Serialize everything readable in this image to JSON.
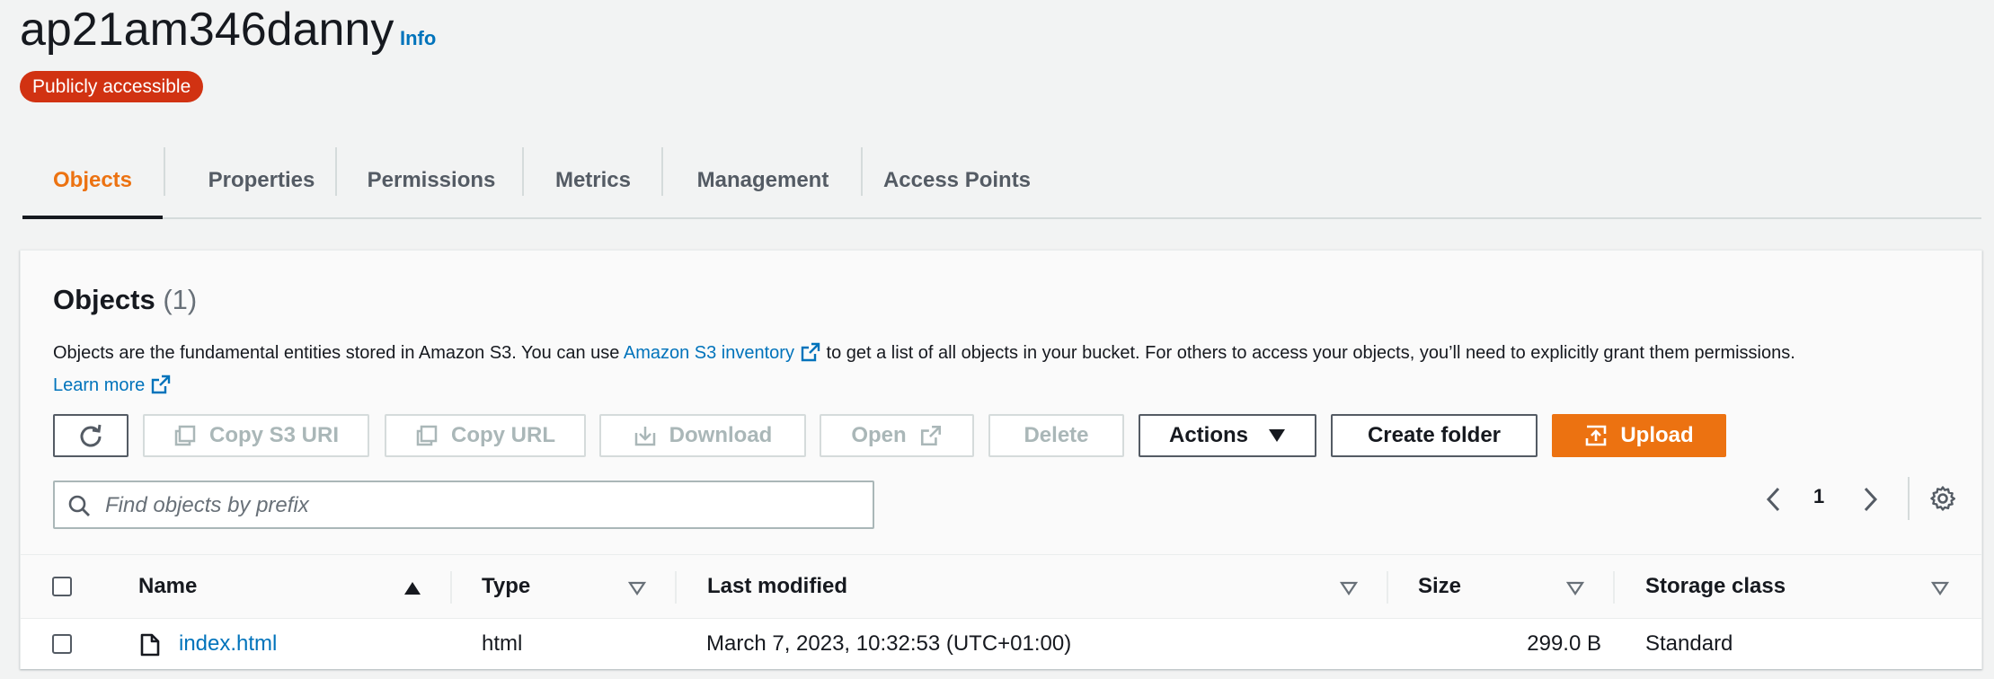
{
  "bucket": {
    "name": "ap21am346danny",
    "info_label": "Info",
    "access_badge": "Publicly accessible"
  },
  "tabs": [
    {
      "label": "Objects",
      "active": true
    },
    {
      "label": "Properties"
    },
    {
      "label": "Permissions"
    },
    {
      "label": "Metrics"
    },
    {
      "label": "Management"
    },
    {
      "label": "Access Points"
    }
  ],
  "objects_panel": {
    "title": "Objects",
    "count": "(1)",
    "description_before": "Objects are the fundamental entities stored in Amazon S3. You can use ",
    "inventory_link": "Amazon S3 inventory",
    "description_after": " to get a list of all objects in your bucket. For others to access your objects, you’ll need to explicitly grant them permissions.",
    "learn_more": "Learn more"
  },
  "toolbar": {
    "refresh_icon": "refresh-icon",
    "copy_s3_uri": "Copy S3 URI",
    "copy_url": "Copy URL",
    "download": "Download",
    "open": "Open",
    "delete": "Delete",
    "actions": "Actions",
    "create_folder": "Create folder",
    "upload": "Upload"
  },
  "search": {
    "placeholder": "Find objects by prefix",
    "value": ""
  },
  "pagination": {
    "current_page": "1"
  },
  "table": {
    "columns": [
      "Name",
      "Type",
      "Last modified",
      "Size",
      "Storage class"
    ],
    "rows": [
      {
        "name": "index.html",
        "type": "html",
        "last_modified": "March 7, 2023, 10:32:53 (UTC+01:00)",
        "size": "299.0 B",
        "storage_class": "Standard"
      }
    ]
  },
  "colors": {
    "accent": "#ec7211",
    "link": "#0073bb",
    "badge_red": "#d13212",
    "text": "#16191f"
  }
}
